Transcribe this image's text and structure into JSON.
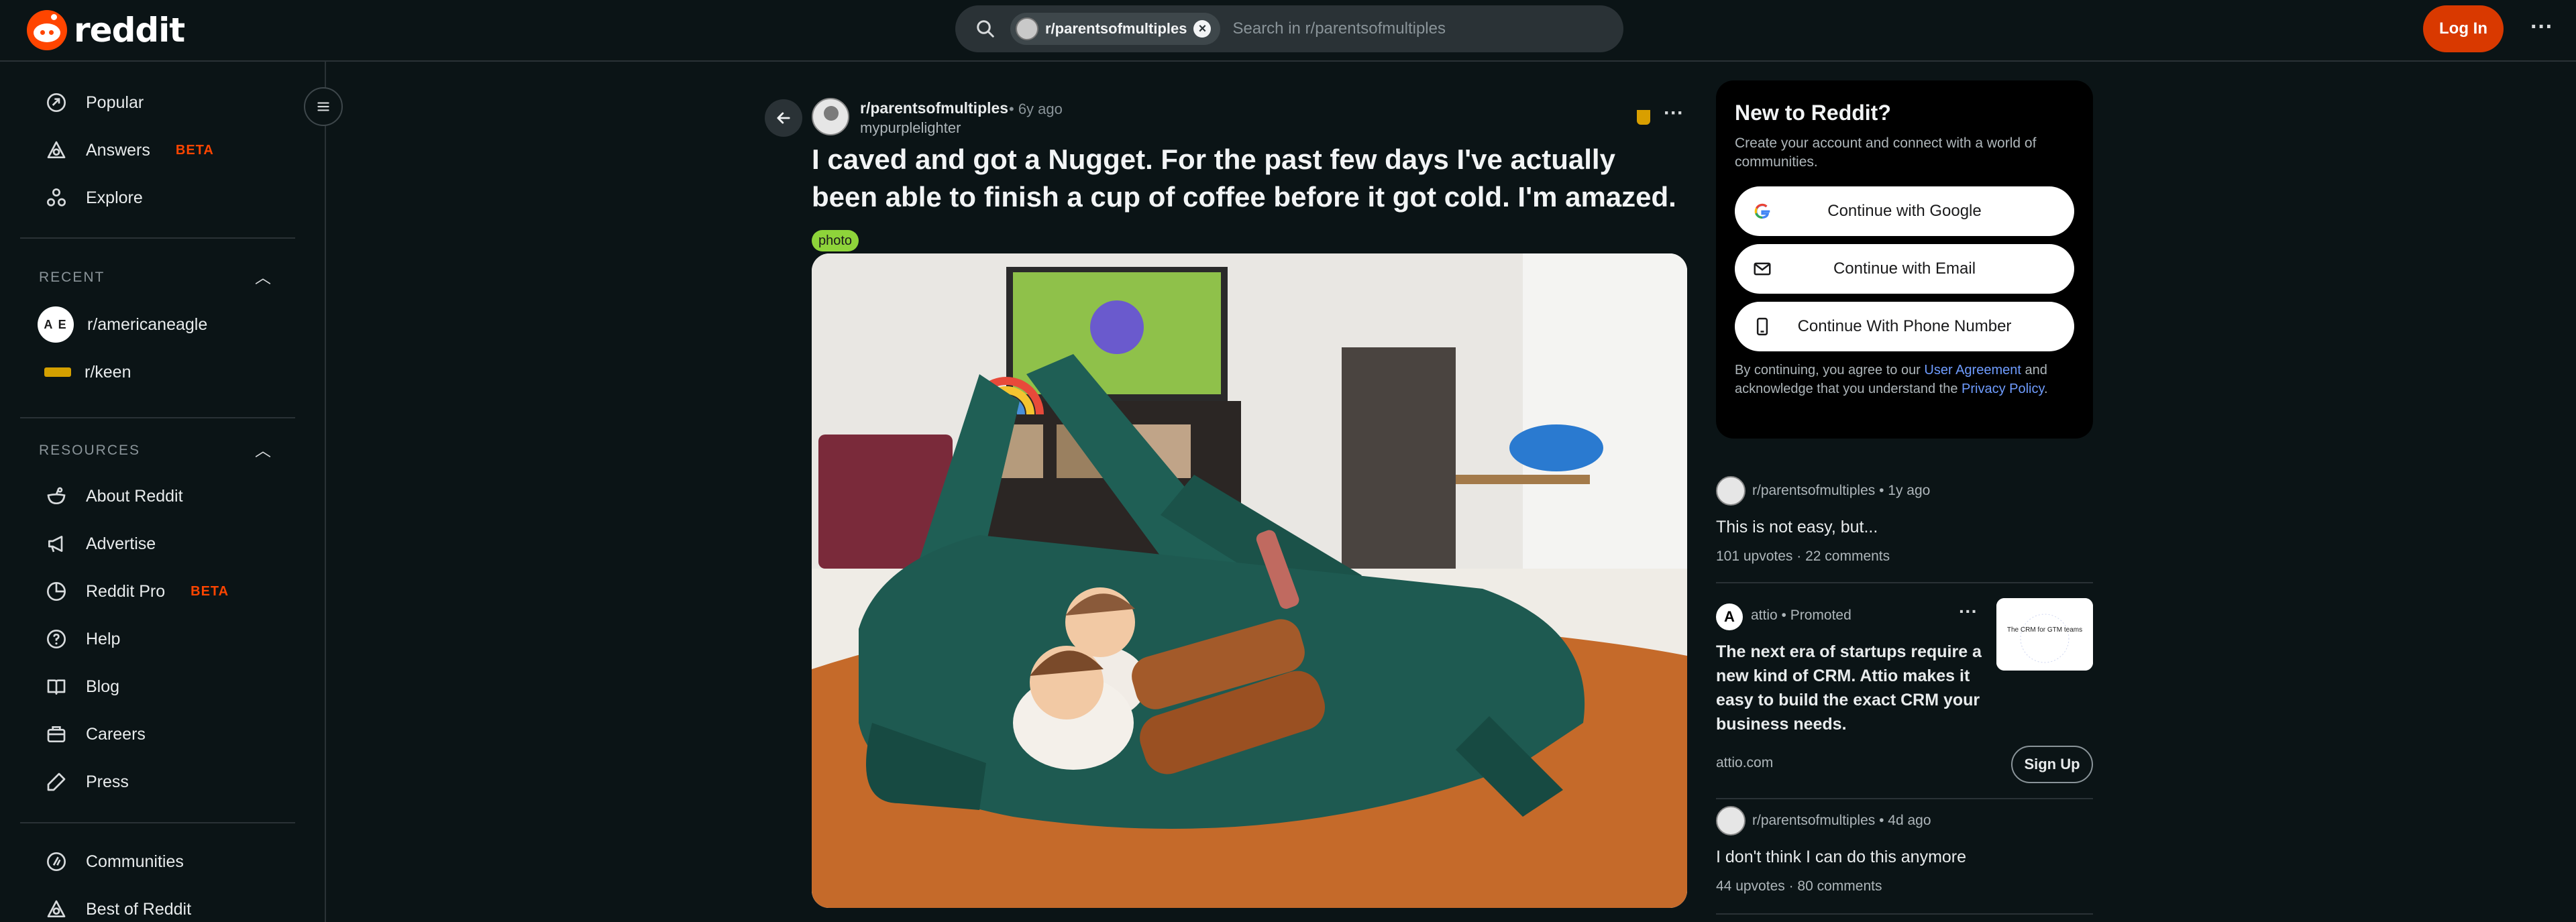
{
  "header": {
    "logo_text": "reddit",
    "search_chip": "r/parentsofmultiples",
    "search_placeholder": "Search in r/parentsofmultiples",
    "login_label": "Log In"
  },
  "sidebar": {
    "top_items": [
      {
        "label": "Popular",
        "icon": "popular-icon"
      },
      {
        "label": "Answers",
        "badge": "BETA",
        "icon": "answers-icon"
      },
      {
        "label": "Explore",
        "icon": "explore-icon"
      }
    ],
    "recent_title": "RECENT",
    "recent": [
      {
        "label": "r/americaneagle",
        "avatar": "A E"
      },
      {
        "label": "r/keen"
      }
    ],
    "resources_title": "RESOURCES",
    "resources": [
      {
        "label": "About Reddit",
        "icon": "about-icon"
      },
      {
        "label": "Advertise",
        "icon": "megaphone-icon"
      },
      {
        "label": "Reddit Pro",
        "badge": "BETA",
        "icon": "pro-icon"
      },
      {
        "label": "Help",
        "icon": "help-icon"
      },
      {
        "label": "Blog",
        "icon": "book-icon"
      },
      {
        "label": "Careers",
        "icon": "briefcase-icon"
      },
      {
        "label": "Press",
        "icon": "pen-icon"
      }
    ],
    "bottom": [
      {
        "label": "Communities",
        "icon": "communities-icon"
      },
      {
        "label": "Best of Reddit",
        "icon": "best-icon"
      }
    ]
  },
  "post": {
    "subreddit": "r/parentsofmultiples",
    "time": "• 6y ago",
    "username": "mypurplelighter",
    "title": "I caved and got a Nugget. For the past few days I've actually been able to finish a cup of coffee before it got cold. I'm amazed.",
    "flair": "photo"
  },
  "signup": {
    "title": "New to Reddit?",
    "subtitle": "Create your account and connect with a world of communities.",
    "google": "Continue with Google",
    "email": "Continue with Email",
    "phone": "Continue With Phone Number",
    "legal_prefix": "By continuing, you agree to our ",
    "legal_link1": "User Agreement",
    "legal_middle": " and acknowledge that you understand the ",
    "legal_link2": "Privacy Policy",
    "legal_suffix": "."
  },
  "feed": [
    {
      "subreddit": "r/parentsofmultiples",
      "time": "• 1y ago",
      "title": "This is not easy, but...",
      "meta": "101 upvotes · 22 comments"
    },
    {
      "subreddit": "r/parentsofmultiples",
      "time": "• 4d ago",
      "title": "I don't think I can do this anymore",
      "meta": "44 upvotes · 80 comments"
    }
  ],
  "ad": {
    "brand": "attio",
    "promoted": "• Promoted",
    "text": "The next era of startups require a new kind of CRM. Attio makes it easy to build the exact CRM your business needs.",
    "domain": "attio.com",
    "cta": "Sign Up",
    "logo_glyph": "A",
    "thumb_caption": "The CRM for GTM teams"
  },
  "colors": {
    "accent": "#ff4500",
    "login": "#d93900",
    "flair": "#8ed43a",
    "link": "#6f9cff"
  }
}
